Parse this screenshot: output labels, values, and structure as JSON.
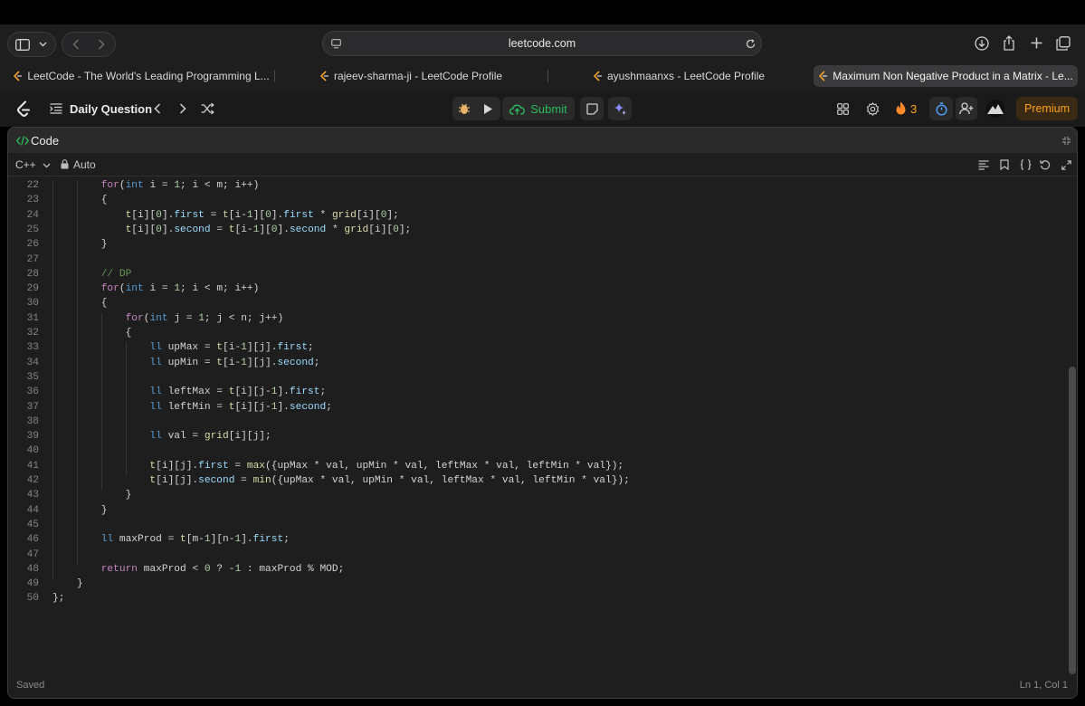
{
  "browser": {
    "url": "leetcode.com",
    "tabs": [
      {
        "title": "LeetCode - The World's Leading Programming L...",
        "active": false
      },
      {
        "title": "rajeev-sharma-ji - LeetCode Profile",
        "active": false
      },
      {
        "title": "ayushmaanxs - LeetCode Profile",
        "active": false
      },
      {
        "title": "Maximum Non Negative Product in a Matrix - Le...",
        "active": true
      }
    ]
  },
  "navbar": {
    "problem_list_label": "Daily Question",
    "submit_label": "Submit",
    "streak_count": "3",
    "premium_label": "Premium"
  },
  "panel": {
    "title": "Code",
    "language": "C++",
    "mode": "Auto",
    "status": "Saved",
    "cursor": "Ln 1, Col 1"
  },
  "colors": {
    "accent_green": "#2cbb5d",
    "premium_orange": "#ffa116",
    "keyword": "#c586c0",
    "type": "#569cd6",
    "number": "#b5cea8",
    "function": "#dcdcaa",
    "member": "#9cdcfe",
    "comment": "#6a9955"
  },
  "code": {
    "line_numbers": [
      "22",
      "23",
      "24",
      "25",
      "26",
      "27",
      "28",
      "29",
      "30",
      "31",
      "32",
      "33",
      "34",
      "35",
      "36",
      "37",
      "38",
      "39",
      "40",
      "41",
      "42",
      "43",
      "44",
      "45",
      "46",
      "47",
      "48",
      "49",
      "50"
    ],
    "lines": [
      "        for(int i = 1; i < m; i++)",
      "        {",
      "            t[i][0].first = t[i-1][0].first * grid[i][0];",
      "            t[i][0].second = t[i-1][0].second * grid[i][0];",
      "        }",
      "",
      "        // DP",
      "        for(int i = 1; i < m; i++)",
      "        {",
      "            for(int j = 1; j < n; j++)",
      "            {",
      "                ll upMax = t[i-1][j].first;",
      "                ll upMin = t[i-1][j].second;",
      "",
      "                ll leftMax = t[i][j-1].first;",
      "                ll leftMin = t[i][j-1].second;",
      "",
      "                ll val = grid[i][j];",
      "",
      "                t[i][j].first = max({upMax * val, upMin * val, leftMax * val, leftMin * val});",
      "                t[i][j].second = min({upMax * val, upMin * val, leftMax * val, leftMin * val});",
      "            }",
      "        }",
      "",
      "        ll maxProd = t[m-1][n-1].first;",
      "",
      "        return maxProd < 0 ? -1 : maxProd % MOD;",
      "    }",
      "};"
    ]
  }
}
